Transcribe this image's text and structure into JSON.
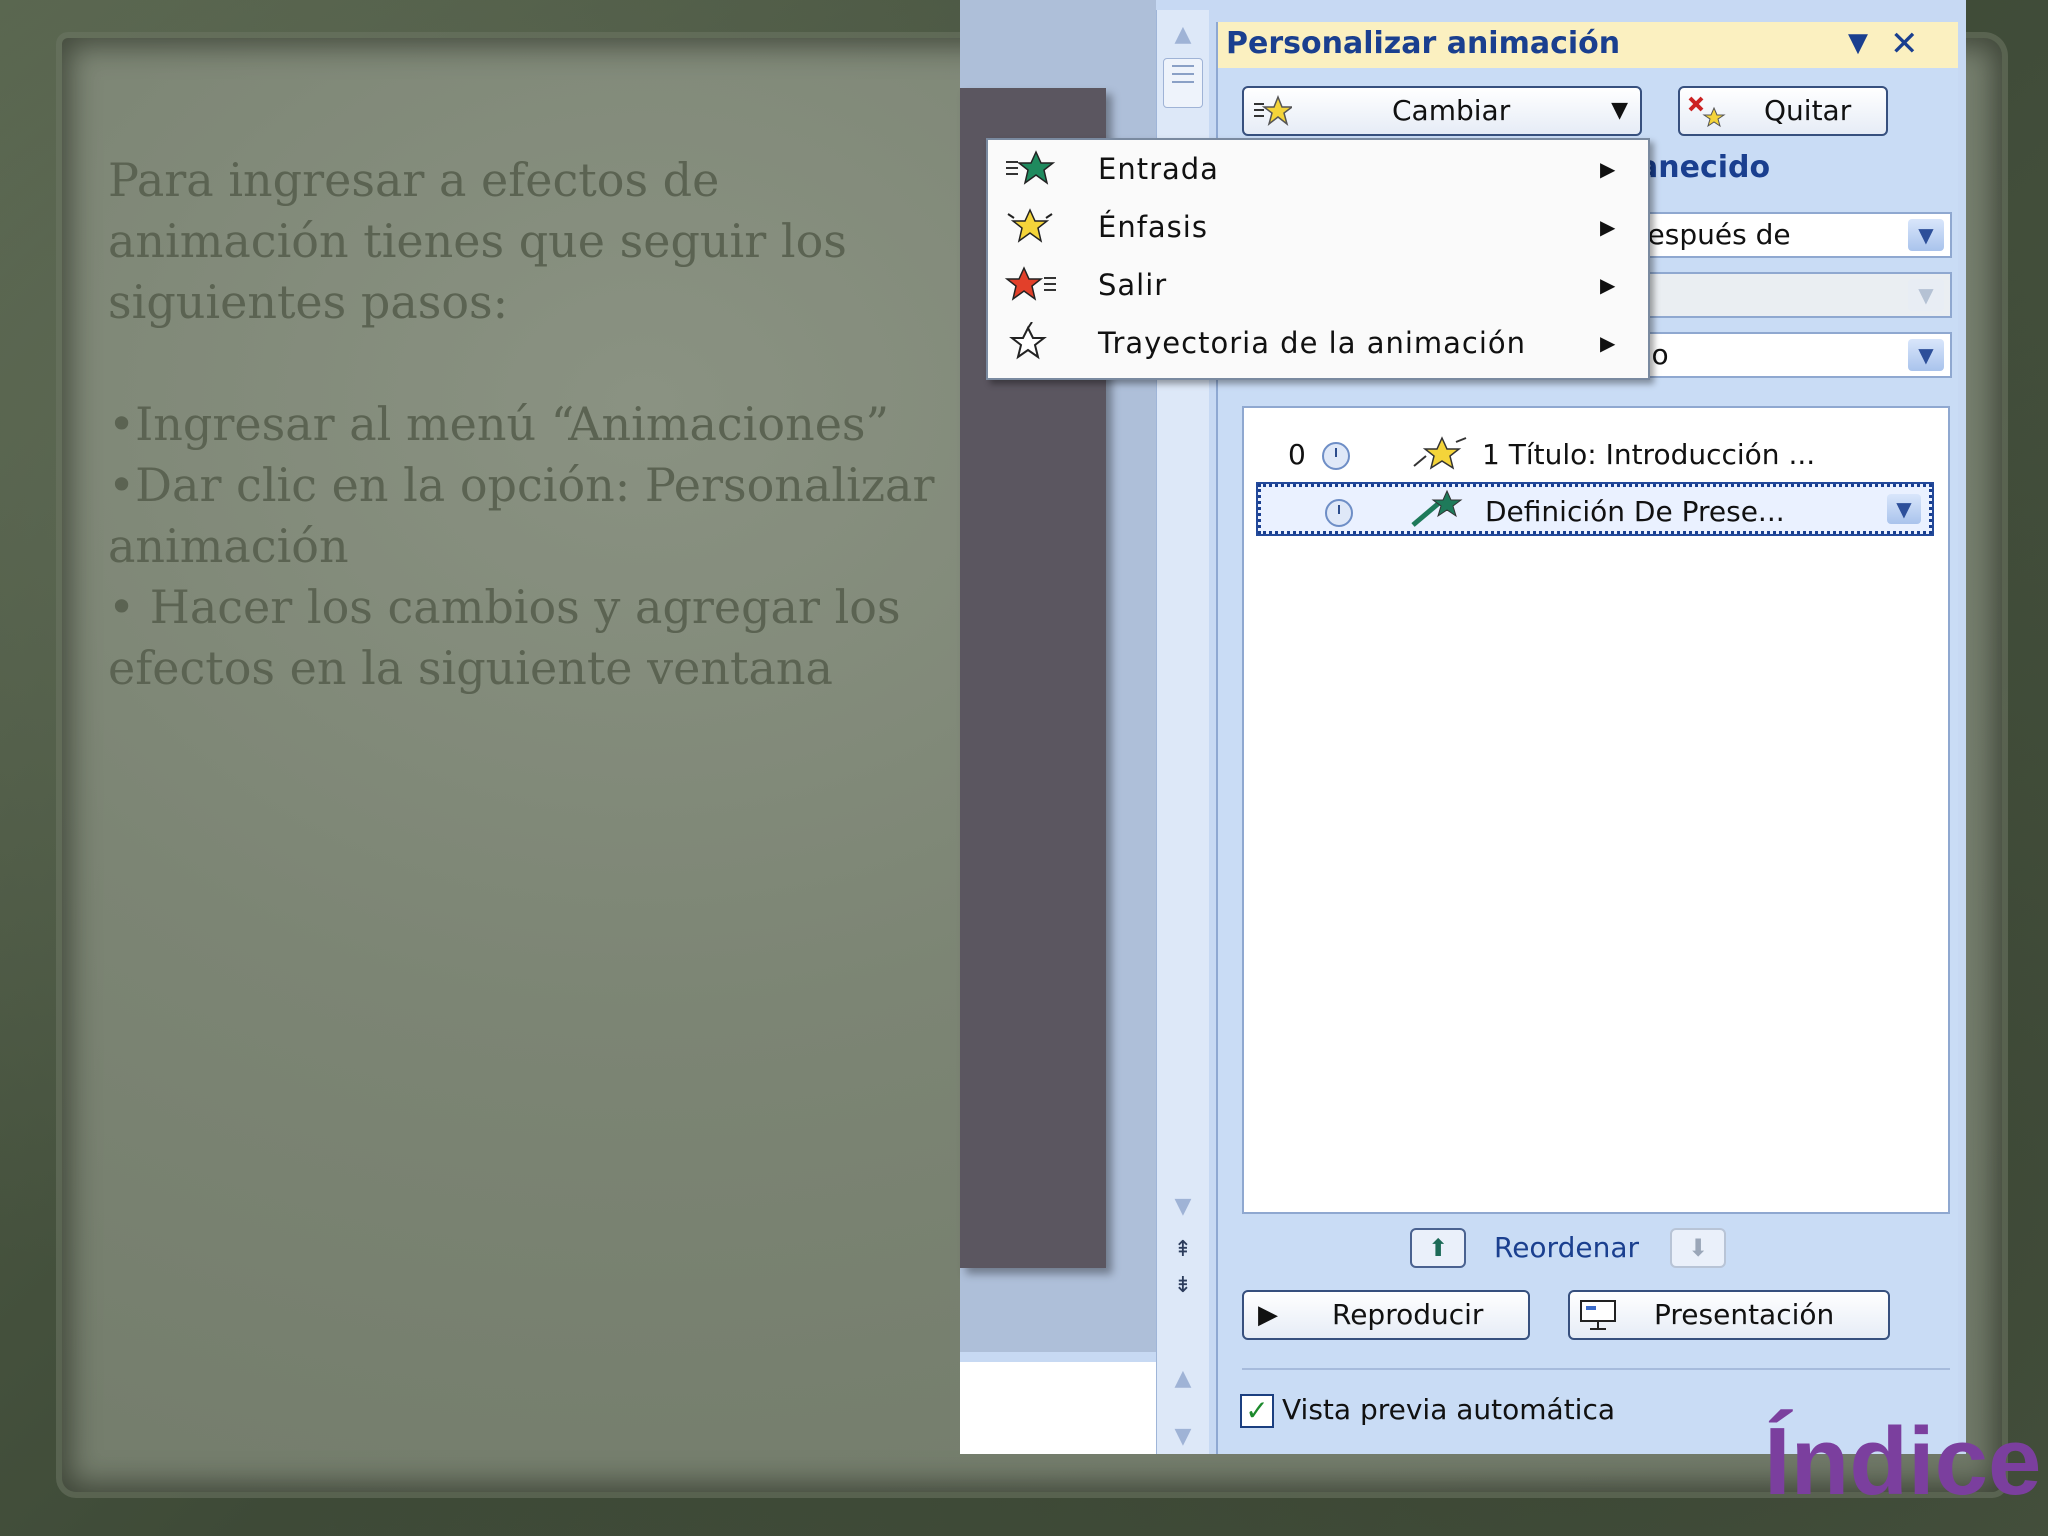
{
  "slide": {
    "paragraphs": [
      "Para ingresar a efectos de",
      "animación  tienes que seguir los",
      "siguientes pasos:",
      "•Ingresar al menú “Animaciones”",
      "•Dar clic en la opción: Personalizar",
      "animación",
      "• Hacer los cambios y agregar los",
      "efectos en la siguiente ventana"
    ],
    "index_link": "Índice"
  },
  "task_pane": {
    "title": "Personalizar animación",
    "change_button": "Cambiar",
    "remove_button": "Quitar",
    "section_label_partial": "anecido",
    "start_combo": "Después de",
    "speed_combo_partial": "dio",
    "effects": [
      {
        "number": "0",
        "label": "1  Título: Introducción ..."
      },
      {
        "number": "",
        "label": "Definición De Prese..."
      }
    ],
    "reorder_label": "Reordenar",
    "play_button": "Reproducir",
    "slideshow_button": "Presentación",
    "autopreview_label": "Vista previa automática",
    "autopreview_checked": true
  },
  "change_menu": {
    "items": [
      {
        "label": "Entrada",
        "icon": "entrance-star-icon"
      },
      {
        "label": "Énfasis",
        "icon": "emphasis-star-icon"
      },
      {
        "label": "Salir",
        "icon": "exit-star-icon"
      },
      {
        "label": "Trayectoria de la animación",
        "icon": "motion-path-star-icon"
      }
    ]
  },
  "colors": {
    "pane_title_text": "#1a3f8f",
    "index_link": "#7b3f9e",
    "slide_text": "#5b6352"
  }
}
